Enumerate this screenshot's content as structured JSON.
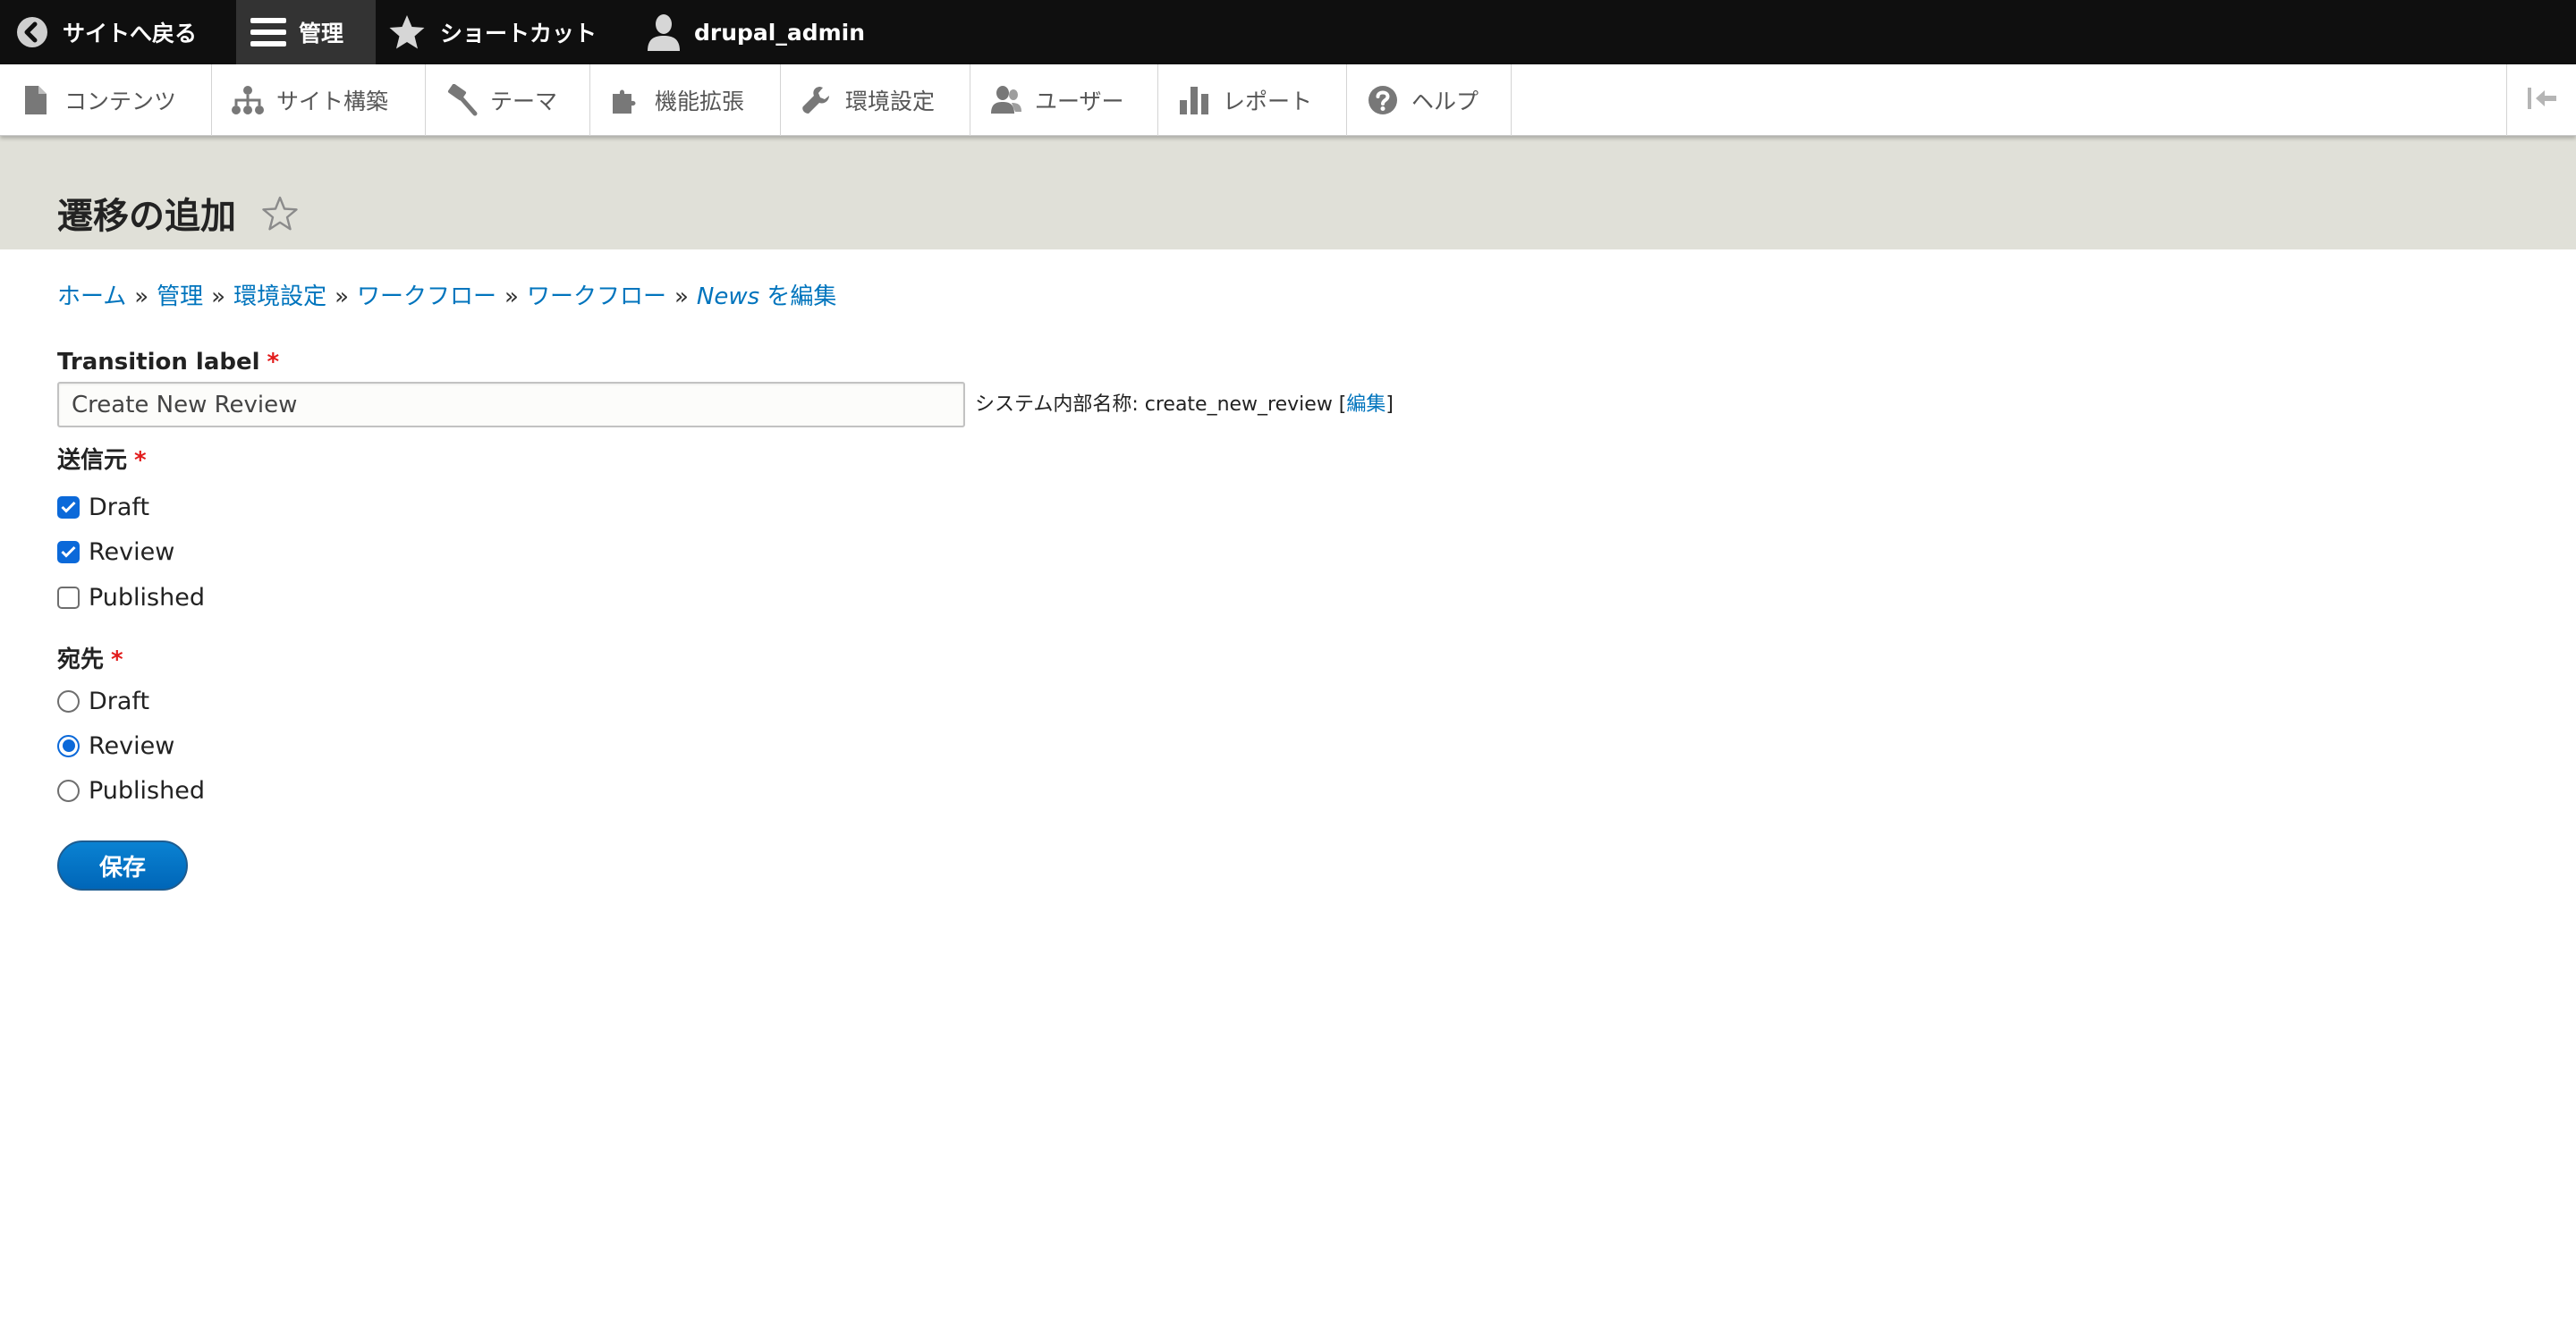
{
  "toolbar": {
    "back_label": "サイトへ戻る",
    "manage_label": "管理",
    "shortcuts_label": "ショートカット",
    "user_label": "drupal_admin"
  },
  "tray": {
    "items": [
      {
        "label": "コンテンツ",
        "icon": "file-icon"
      },
      {
        "label": "サイト構築",
        "icon": "sitemap-icon"
      },
      {
        "label": "テーマ",
        "icon": "paint-roller-icon"
      },
      {
        "label": "機能拡張",
        "icon": "puzzle-icon"
      },
      {
        "label": "環境設定",
        "icon": "wrench-icon"
      },
      {
        "label": "ユーザー",
        "icon": "people-icon"
      },
      {
        "label": "レポート",
        "icon": "bar-chart-icon"
      },
      {
        "label": "ヘルプ",
        "icon": "help-icon"
      }
    ]
  },
  "page": {
    "title": "遷移の追加"
  },
  "breadcrumb": {
    "items": [
      "ホーム",
      "管理",
      "環境設定",
      "ワークフロー",
      "ワークフロー"
    ],
    "last_italic": "News",
    "last_suffix": " を編集",
    "separator": "»"
  },
  "form": {
    "label_field": {
      "label": "Transition label",
      "required_mark": "*",
      "value": "Create New Review"
    },
    "machine_name": {
      "prefix": "システム内部名称: create_new_review [",
      "edit_link": "編集",
      "suffix": "]"
    },
    "from": {
      "label": "送信元",
      "required_mark": "*",
      "options": [
        {
          "label": "Draft",
          "checked": true
        },
        {
          "label": "Review",
          "checked": true
        },
        {
          "label": "Published",
          "checked": false
        }
      ]
    },
    "to": {
      "label": "宛先",
      "required_mark": "*",
      "options": [
        {
          "label": "Draft",
          "selected": false
        },
        {
          "label": "Review",
          "selected": true
        },
        {
          "label": "Published",
          "selected": false
        }
      ]
    },
    "save_label": "保存"
  },
  "colors": {
    "link": "#0074bd",
    "required": "#e21b1b",
    "primary_button": "#0074bd",
    "header_bg": "#e0e0d8",
    "toolbar_bg": "#0f0f0f"
  }
}
